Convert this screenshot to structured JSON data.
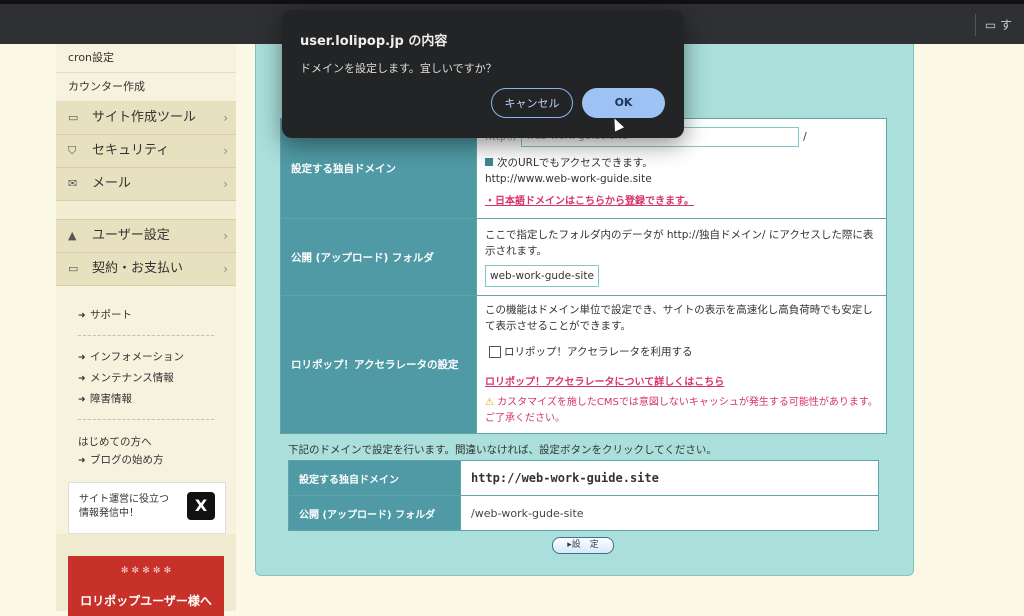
{
  "topbar": {
    "folder_icon": "folder-icon",
    "folder_label": "す"
  },
  "sidebar": {
    "small_items": [
      "cron設定",
      "カウンター作成"
    ],
    "nav_items": [
      {
        "icon": "laptop-icon",
        "glyph": "▭",
        "label": "サイト作成ツール"
      },
      {
        "icon": "shield-icon",
        "glyph": "⛉",
        "label": "セキュリティ"
      },
      {
        "icon": "mail-icon",
        "glyph": "✉",
        "label": "メール"
      },
      {
        "icon": "user-icon",
        "glyph": "▲",
        "label": "ユーザー設定"
      },
      {
        "icon": "card-icon",
        "glyph": "▭",
        "label": "契約・お支払い"
      }
    ],
    "links_a": [
      "サポート"
    ],
    "links_b": [
      "インフォメーション",
      "メンテナンス情報",
      "障害情報"
    ],
    "first_time": "はじめての方へ",
    "blog_link": "ブログの始め方",
    "x_promo_line1": "サイト運営に役立つ",
    "x_promo_line2": "情報発信中！",
    "x_logo": "X",
    "banner_text": "ロリポップユーザー様へ"
  },
  "form": {
    "row1": {
      "label": "設定する独自ドメイン",
      "prefix": "http://",
      "input_value": "web-work-guide.site",
      "suffix": "/",
      "note": "次のURLでもアクセスできます。",
      "alt_url": "http://www.web-work-guide.site",
      "jp_domain_link": "・日本語ドメインはこちらから登録できます。"
    },
    "row2": {
      "label": "公開 (アップロード) フォルダ",
      "desc": "ここで指定したフォルダ内のデータが http://独自ドメイン/ にアクセスした際に表示されます。",
      "input_value": "web-work-gude-site"
    },
    "row3": {
      "label": "ロリポップ！アクセラレータの設定",
      "desc": "この機能はドメイン単位で設定でき、サイトの表示を高速化し高負荷時でも安定して表示させることができます。",
      "checkbox_label": "ロリポップ！アクセラレータを利用する",
      "detail_link": "ロリポップ！アクセラレータについて詳しくはこちら",
      "warning": "カスタマイズを施したCMSでは意図しないキャッシュが発生する可能性があります。ご了承ください。"
    }
  },
  "confirm": {
    "message": "下記のドメインで設定を行います。間違いなければ、設定ボタンをクリックしてください。",
    "domain_label": "設定する独自ドメイン",
    "domain_value": "http://web-work-guide.site",
    "folder_label": "公開 (アップロード) フォルダ",
    "folder_value": "/web-work-gude-site",
    "submit_label": "▸設　定"
  },
  "dialog": {
    "title": "user.lolipop.jp の内容",
    "message": "ドメインを設定します。宜しいですか？",
    "cancel_label": "キャンセル",
    "ok_label": "OK"
  }
}
